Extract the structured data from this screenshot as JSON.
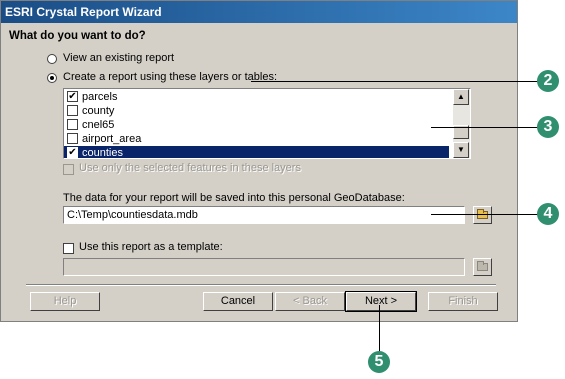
{
  "window": {
    "title": "ESRI Crystal Report Wizard"
  },
  "question": "What do you want to do?",
  "options": {
    "existing": "View an existing report",
    "create": "Create a report using these layers or tables:"
  },
  "layers": [
    {
      "name": "parcels",
      "checked": true,
      "selected": false
    },
    {
      "name": "county",
      "checked": false,
      "selected": false
    },
    {
      "name": "cnel65",
      "checked": false,
      "selected": false
    },
    {
      "name": "airport_area",
      "checked": false,
      "selected": false
    },
    {
      "name": "counties",
      "checked": true,
      "selected": true
    }
  ],
  "selected_only_label": "Use only the selected features in these layers",
  "save": {
    "label": "The data for your report will be saved into this personal GeoDatabase:",
    "path": "C:\\Temp\\countiesdata.mdb"
  },
  "template": {
    "label": "Use this report as a template:",
    "path": ""
  },
  "buttons": {
    "help": "Help",
    "cancel": "Cancel",
    "back": "< Back",
    "next": "Next >",
    "finish": "Finish"
  },
  "callouts": [
    "2",
    "3",
    "4",
    "5"
  ],
  "colors": {
    "callout": "#2f8f6f",
    "selection": "#0a246a",
    "titlebar": "#1a4d86"
  }
}
